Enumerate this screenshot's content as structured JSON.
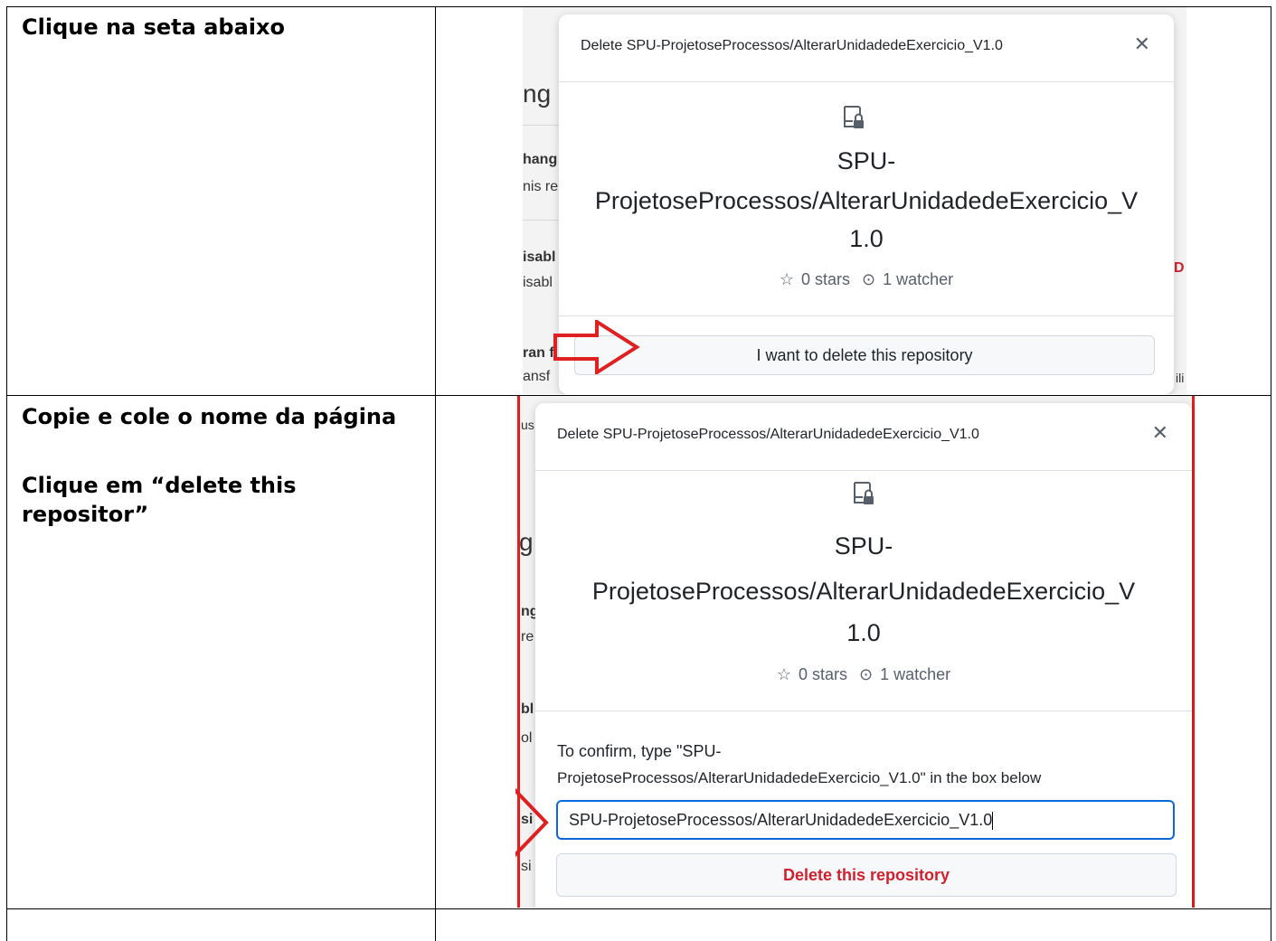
{
  "rows": [
    {
      "instructions": [
        "Clique na seta abaixo"
      ]
    },
    {
      "instructions": [
        "Copie e cole o nome da página",
        "Clique em “delete this repositor”"
      ]
    },
    {
      "instructions": []
    }
  ],
  "screenshot1": {
    "background_fragments": [
      "ng",
      "hang",
      "nis re",
      "isabl",
      "isabl",
      "ran f",
      "ansf",
      "D",
      "ili"
    ],
    "modal": {
      "title": "Delete SPU-ProjetoseProcessos/AlterarUnidadedeExercicio_V1.0",
      "close_icon": "close-icon",
      "repo_icon": "repo-locked-icon",
      "repo_name_line1": "SPU-",
      "repo_name_line2": "ProjetoseProcessos/AlterarUnidadedeExercicio_V",
      "repo_name_line3": "1.0",
      "stars": "0 stars",
      "watchers": "1 watcher",
      "button_label": "I want to delete this repository"
    },
    "annotation": "red-arrow-icon"
  },
  "screenshot2": {
    "background_fragments": [
      "us",
      "g",
      "ng",
      "re",
      "bl",
      "ol",
      "si",
      "si"
    ],
    "modal": {
      "title": "Delete SPU-ProjetoseProcessos/AlterarUnidadedeExercicio_V1.0",
      "close_icon": "close-icon",
      "repo_icon": "repo-locked-icon",
      "repo_name_line1": "SPU-",
      "repo_name_line2": "ProjetoseProcessos/AlterarUnidadedeExercicio_V",
      "repo_name_line3": "1.0",
      "stars": "0 stars",
      "watchers": "1 watcher",
      "confirm_line1": "To confirm, type \"SPU-",
      "confirm_line2": "ProjetoseProcessos/AlterarUnidadedeExercicio_V1.0\" in the box below",
      "input_value": "SPU-ProjetoseProcessos/AlterarUnidadedeExercicio_V1.0",
      "button_label": "Delete this repository"
    },
    "annotation": "red-arrow-icon"
  },
  "colors": {
    "danger": "#cf222e",
    "focus": "#0969da",
    "annotation": "#e02020"
  }
}
